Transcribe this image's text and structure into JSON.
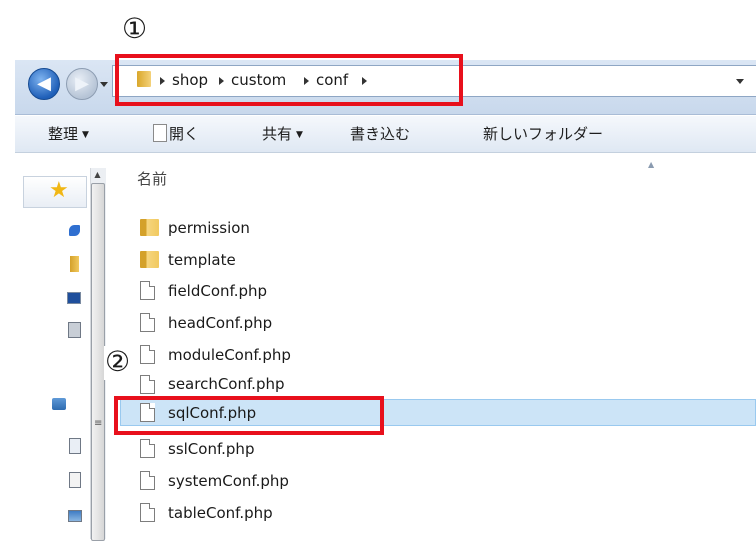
{
  "annotations": {
    "marker_1": "①",
    "marker_2": "②"
  },
  "breadcrumb": [
    "shop",
    "custom",
    "conf"
  ],
  "toolbar": {
    "organize": "整理",
    "open": "開く",
    "share": "共有",
    "burn": "書き込む",
    "new_folder": "新しいフォルダー"
  },
  "file_list": {
    "column_name": "名前",
    "items": [
      {
        "name": "permission",
        "type": "folder"
      },
      {
        "name": "template",
        "type": "folder"
      },
      {
        "name": "fieldConf.php",
        "type": "file"
      },
      {
        "name": "headConf.php",
        "type": "file"
      },
      {
        "name": "moduleConf.php",
        "type": "file"
      },
      {
        "name": "searchConf.php",
        "type": "file"
      },
      {
        "name": "sqlConf.php",
        "type": "file",
        "selected": true
      },
      {
        "name": "sslConf.php",
        "type": "file"
      },
      {
        "name": "systemConf.php",
        "type": "file"
      },
      {
        "name": "tableConf.php",
        "type": "file"
      }
    ]
  },
  "colors": {
    "highlight_box": "#e8101c",
    "selection": "#cce4f7"
  }
}
